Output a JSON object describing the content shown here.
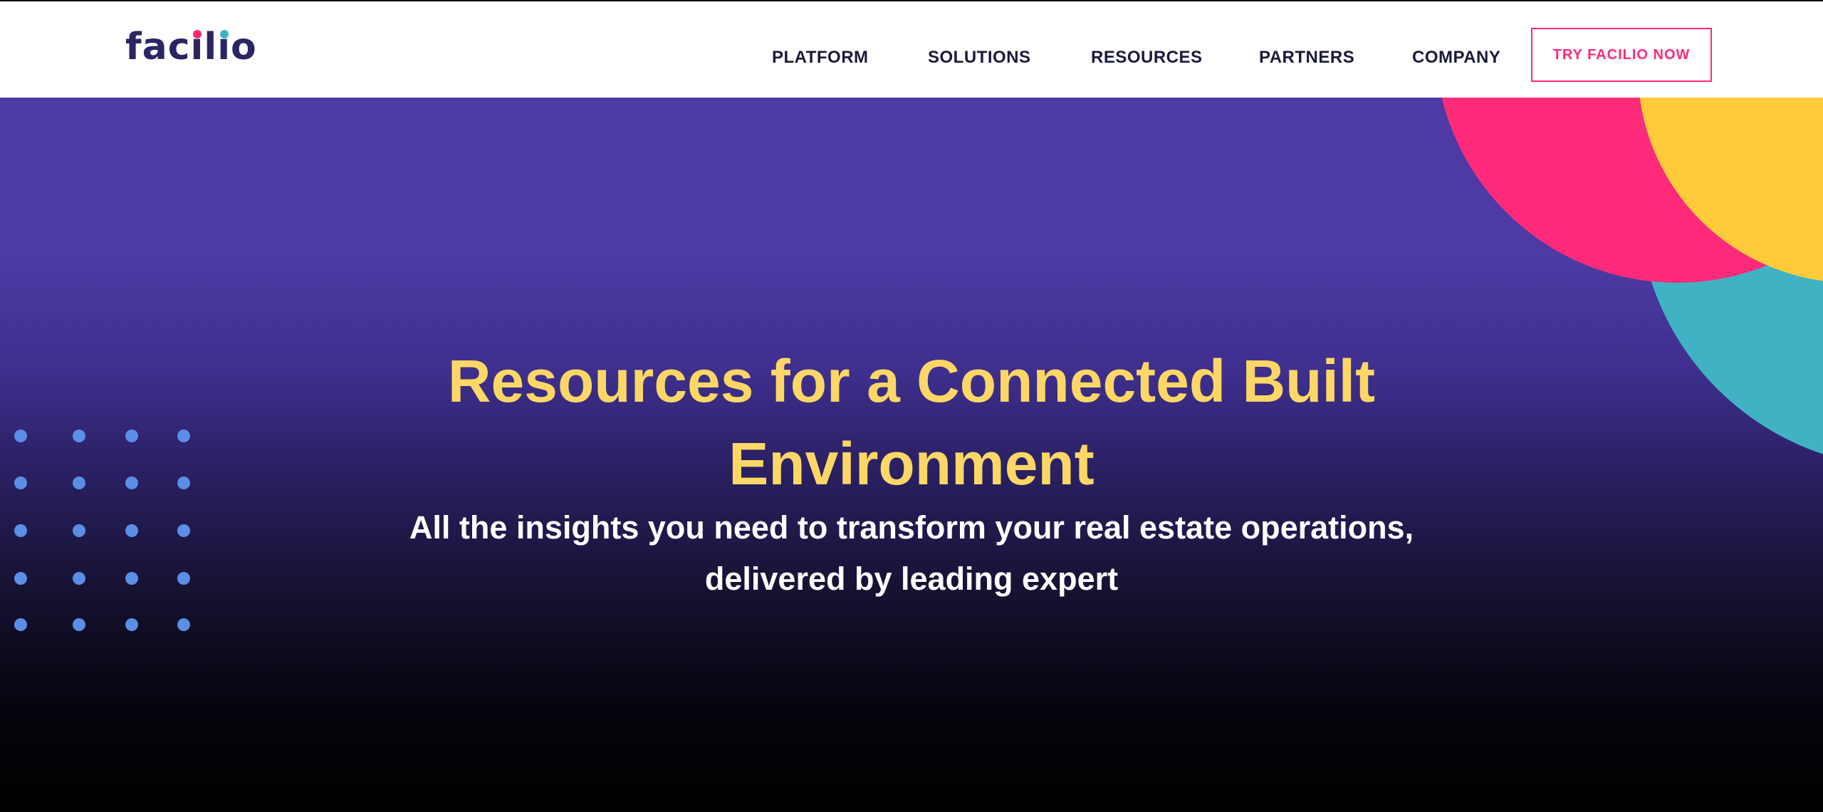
{
  "header": {
    "logo_text": "facilio",
    "nav": [
      "PLATFORM",
      "SOLUTIONS",
      "RESOURCES",
      "PARTNERS",
      "COMPANY"
    ],
    "cta_label": "TRY FACILIO NOW"
  },
  "hero": {
    "title": "Resources for a Connected Built Environment",
    "subtitle": "All the insights you need to transform your real estate operations, delivered by leading expert"
  },
  "colors": {
    "brand_navy": "#2b2563",
    "accent_pink": "#ff2a7a",
    "accent_yellow": "#ffcb3a",
    "accent_teal": "#3fb3c4",
    "hero_purple": "#4d3aa4",
    "title_yellow": "#fcd765",
    "dot_blue": "#5b8ee6"
  }
}
